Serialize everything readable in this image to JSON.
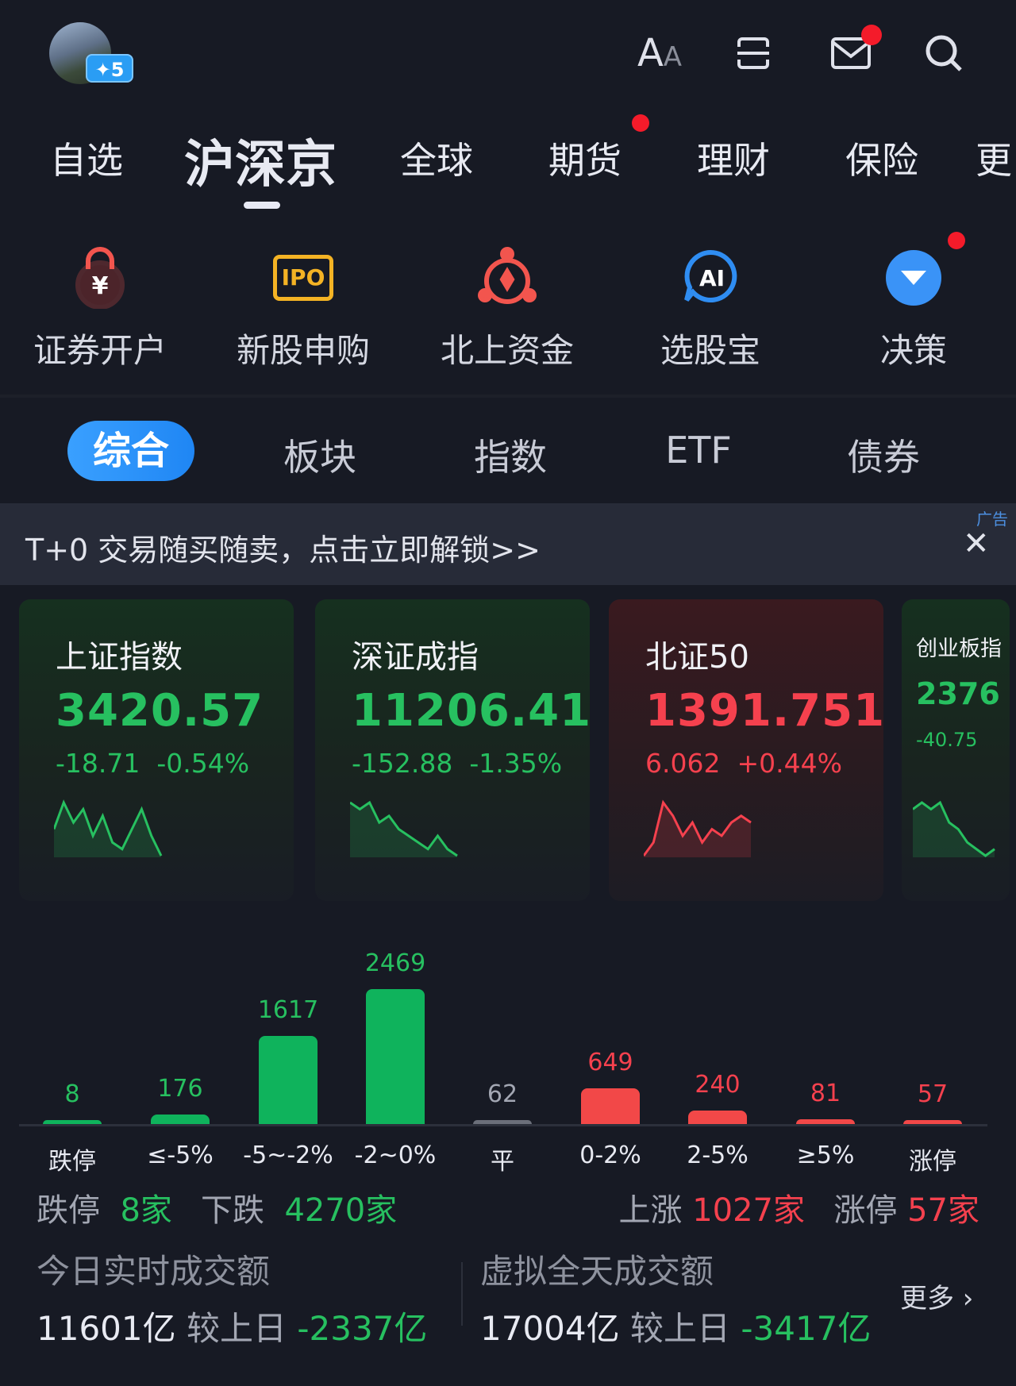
{
  "header": {
    "level_badge": "✦5",
    "icons": [
      "font-size-icon",
      "scan-icon",
      "mail-icon",
      "search-icon"
    ],
    "mail_has_notification": true
  },
  "top_tabs": [
    {
      "label": "自选"
    },
    {
      "label": "沪深京",
      "active": true
    },
    {
      "label": "全球"
    },
    {
      "label": "期货",
      "badge": true
    },
    {
      "label": "理财"
    },
    {
      "label": "保险"
    },
    {
      "label": "更"
    }
  ],
  "quick_actions": [
    {
      "label": "证券开户",
      "icon": "lock-yen-icon"
    },
    {
      "label": "新股申购",
      "icon": "ipo-icon",
      "icon_text": "IPO"
    },
    {
      "label": "北上资金",
      "icon": "bauhinia-icon"
    },
    {
      "label": "选股宝",
      "icon": "ai-icon",
      "icon_text": "AI"
    },
    {
      "label": "决策",
      "icon": "dropdown-circle-icon",
      "badge": true
    }
  ],
  "segments": [
    {
      "label": "综合",
      "active": true
    },
    {
      "label": "板块"
    },
    {
      "label": "指数"
    },
    {
      "label": "ETF"
    },
    {
      "label": "债券"
    }
  ],
  "ad": {
    "text": "T+0 交易随买随卖，点击立即解锁>>",
    "tag": "广告"
  },
  "indices": [
    {
      "name": "上证指数",
      "value": "3420.57",
      "change": "-18.71",
      "pct": "-0.54%",
      "trend": "down",
      "sparkline": [
        5,
        9,
        6,
        8,
        4,
        7,
        3,
        2,
        5,
        8,
        4,
        1
      ]
    },
    {
      "name": "深证成指",
      "value": "11206.41",
      "change": "-152.88",
      "pct": "-1.35%",
      "trend": "down",
      "sparkline": [
        9,
        8,
        9,
        6,
        7,
        5,
        4,
        3,
        2,
        4,
        2,
        1
      ]
    },
    {
      "name": "北证50",
      "value": "1391.751",
      "change": "6.062",
      "pct": "+0.44%",
      "trend": "up",
      "sparkline": [
        1,
        3,
        9,
        7,
        4,
        6,
        3,
        5,
        4,
        6,
        7,
        6
      ]
    },
    {
      "name": "创业板指",
      "value": "2376",
      "change": "-40.75",
      "pct": "",
      "trend": "down",
      "sparkline": [
        8,
        9,
        8,
        9,
        6,
        5,
        3,
        2,
        1,
        2
      ]
    }
  ],
  "colors": {
    "up": "#f5414e",
    "down": "#27c060",
    "bar_down": "#0fb35c",
    "bar_flat": "#6b6f7a",
    "bar_up": "#f24848",
    "accent": "#2a8ff7"
  },
  "chart_data": {
    "type": "bar",
    "categories": [
      "跌停",
      "≤-5%",
      "-5~-2%",
      "-2~0%",
      "平",
      "0-2%",
      "2-5%",
      "≥5%",
      "涨停"
    ],
    "values": [
      8,
      176,
      1617,
      2469,
      62,
      649,
      240,
      81,
      57
    ],
    "kinds": [
      "down",
      "down",
      "down",
      "down",
      "flat",
      "up",
      "up",
      "up",
      "up"
    ]
  },
  "summary": {
    "limit_down_label": "跌停",
    "limit_down": "8家",
    "down_label": "下跌",
    "down": "4270家",
    "up_label": "上涨",
    "up": "1027家",
    "limit_up_label": "涨停",
    "limit_up": "57家"
  },
  "turnover": {
    "today_label": "今日实时成交额",
    "today_value": "11601亿",
    "today_cmp_label": "较上日",
    "today_cmp": "-2337亿",
    "virtual_label": "虚拟全天成交额",
    "virtual_value": "17004亿",
    "virtual_cmp_label": "较上日",
    "virtual_cmp": "-3417亿",
    "more": "更多 ›"
  }
}
